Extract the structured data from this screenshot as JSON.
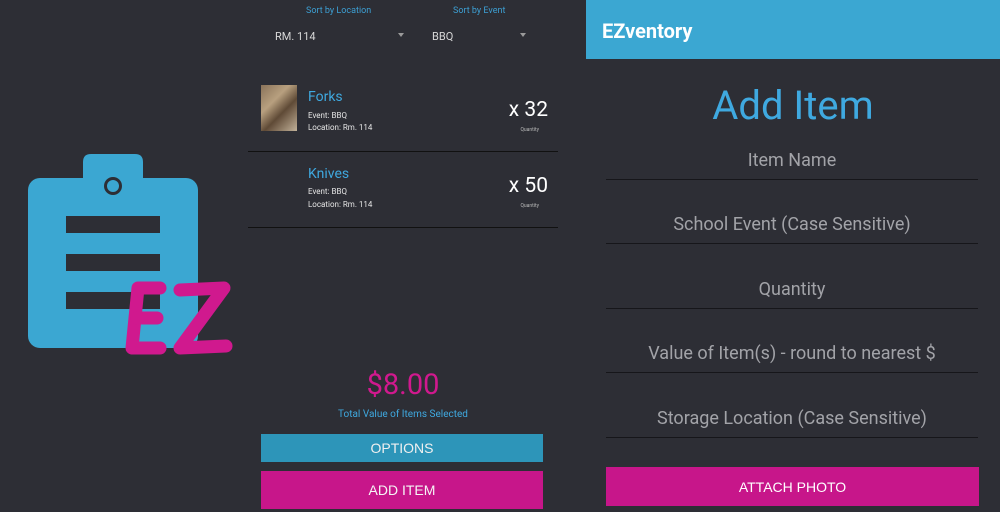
{
  "logo": {
    "text": "EZ",
    "icon": "clipboard-icon",
    "colors": {
      "clipboard": "#3ba7d2",
      "lines": "#2d2e35",
      "ez": "#d0198e"
    }
  },
  "inventory": {
    "sort": [
      {
        "label": "Sort by Location",
        "value": "RM. 114"
      },
      {
        "label": "Sort by Event",
        "value": "BBQ"
      }
    ],
    "items": [
      {
        "name": "Forks",
        "event": "Event: BBQ",
        "location": "Location: Rm. 114",
        "quantity": "x 32",
        "quantity_label": "Quantity",
        "has_photo": true
      },
      {
        "name": "Knives",
        "event": "Event: BBQ",
        "location": "Location: Rm. 114",
        "quantity": "x 50",
        "quantity_label": "Quantity",
        "has_photo": false
      }
    ],
    "total_value": "$8.00",
    "total_label": "Total Value of Items Selected",
    "options_button": "OPTIONS",
    "add_item_button": "ADD ITEM"
  },
  "add_form": {
    "app_title": "EZventory",
    "heading": "Add Item",
    "fields": [
      "Item Name",
      "School Event (Case Sensitive)",
      "Quantity",
      "Value of Item(s) - round to nearest $",
      "Storage Location (Case Sensitive)"
    ],
    "attach_photo_button": "ATTACH PHOTO"
  },
  "colors": {
    "background": "#2d2e35",
    "accent_blue": "#3fa9e0",
    "app_bar": "#3ba7d2",
    "options_button": "#2d95b9",
    "magenta": "#c7168a"
  }
}
